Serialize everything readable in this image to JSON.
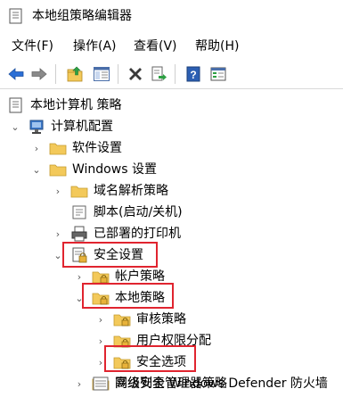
{
  "window": {
    "title": "本地组策略编辑器"
  },
  "menu": {
    "file": "文件(F)",
    "action": "操作(A)",
    "view": "查看(V)",
    "help": "帮助(H)"
  },
  "toolbar": {
    "buttons": [
      "back-icon",
      "forward-icon",
      "up-folder-icon",
      "show-hide-tree-icon",
      "delete-icon",
      "export-list-icon",
      "help-icon",
      "properties-icon"
    ]
  },
  "tree": {
    "root": "本地计算机 策略",
    "computer_config": "计算机配置",
    "software_settings": "软件设置",
    "windows_settings": "Windows 设置",
    "dns_policy": "域名解析策略",
    "scripts": "脚本(启动/关机)",
    "printers": "已部署的打印机",
    "security_settings": "安全设置",
    "account_policies": "帐户策略",
    "local_policies": "本地策略",
    "audit_policy": "审核策略",
    "user_rights": "用户权限分配",
    "security_options": "安全选项",
    "defender_firewall": "高级安全 Windows Defender 防火墙",
    "network_list": "网络列表管理器策略"
  },
  "highlight_color": "#e0242f",
  "folder_color": "#f3c95a"
}
